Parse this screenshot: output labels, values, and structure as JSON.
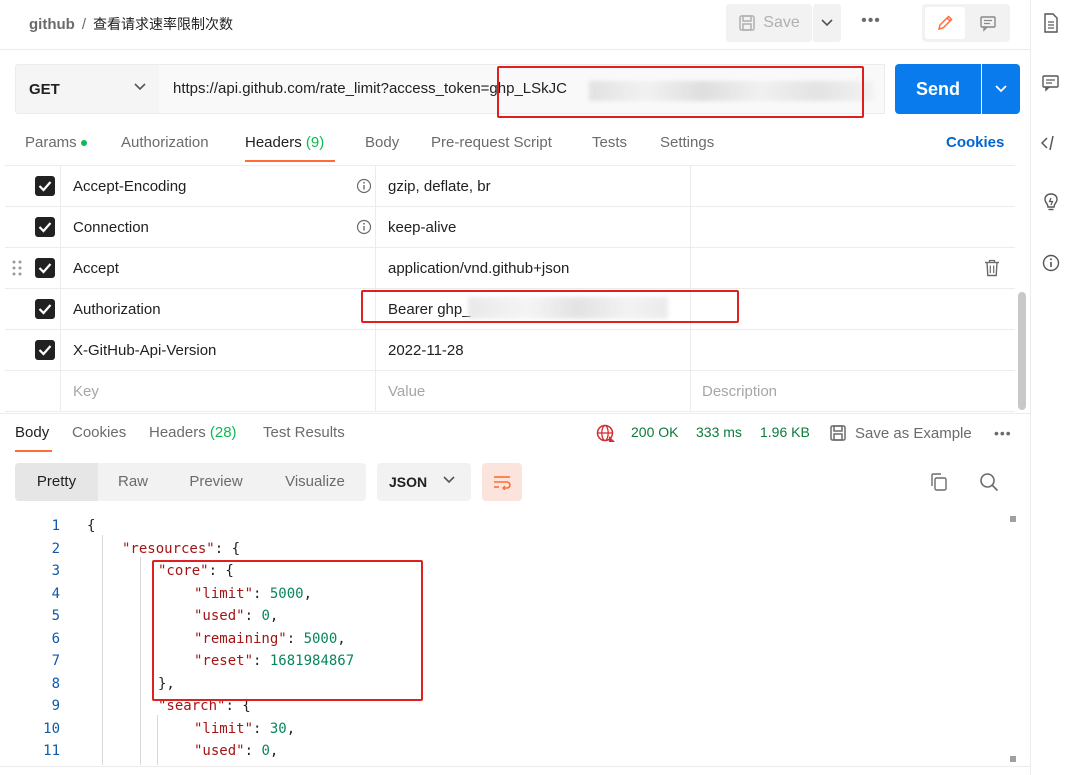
{
  "breadcrumb": {
    "root": "github",
    "separator": "/",
    "title": "查看请求速率限制次数"
  },
  "toolbar": {
    "save_label": "Save",
    "more": "•••"
  },
  "request": {
    "method": "GET",
    "url": "https://api.github.com/rate_limit?access_token=ghp_LSkJC",
    "send_label": "Send"
  },
  "request_tabs": {
    "params": "Params",
    "authorization": "Authorization",
    "headers": "Headers",
    "headers_count": "(9)",
    "body": "Body",
    "pre_request": "Pre-request Script",
    "tests": "Tests",
    "settings": "Settings",
    "cookies": "Cookies"
  },
  "headers": [
    {
      "key": "Accept-Encoding",
      "value": "gzip, deflate, br"
    },
    {
      "key": "Connection",
      "value": "keep-alive"
    },
    {
      "key": "Accept",
      "value": "application/vnd.github+json"
    },
    {
      "key": "Authorization",
      "value": "Bearer ghp_"
    },
    {
      "key": "X-GitHub-Api-Version",
      "value": "2022-11-28"
    }
  ],
  "headers_placeholder": {
    "key": "Key",
    "value": "Value",
    "description": "Description"
  },
  "response_tabs": {
    "body": "Body",
    "cookies": "Cookies",
    "headers": "Headers",
    "headers_count": "(28)",
    "test_results": "Test Results"
  },
  "response_status": {
    "status": "200 OK",
    "time": "333 ms",
    "size": "1.96 KB",
    "save_example": "Save as Example",
    "more": "•••"
  },
  "response_view": {
    "pretty": "Pretty",
    "raw": "Raw",
    "preview": "Preview",
    "visualize": "Visualize",
    "format": "JSON"
  },
  "code_lines": [
    {
      "n": "1"
    },
    {
      "n": "2"
    },
    {
      "n": "3"
    },
    {
      "n": "4"
    },
    {
      "n": "5"
    },
    {
      "n": "6"
    },
    {
      "n": "7"
    },
    {
      "n": "8"
    },
    {
      "n": "9"
    },
    {
      "n": "10"
    },
    {
      "n": "11"
    }
  ],
  "code": {
    "resources_key": "\"resources\"",
    "core_key": "\"core\"",
    "limit_key": "\"limit\"",
    "used_key": "\"used\"",
    "remaining_key": "\"remaining\"",
    "reset_key": "\"reset\"",
    "search_key": "\"search\"",
    "core_limit": "5000",
    "core_used": "0",
    "core_remaining": "5000",
    "core_reset": "1681984867",
    "search_limit": "30",
    "search_used": "0"
  },
  "colors": {
    "accent": "#ff6c37",
    "send": "#097bed",
    "status_ok": "#0cbb52",
    "highlight": "#e02020"
  }
}
